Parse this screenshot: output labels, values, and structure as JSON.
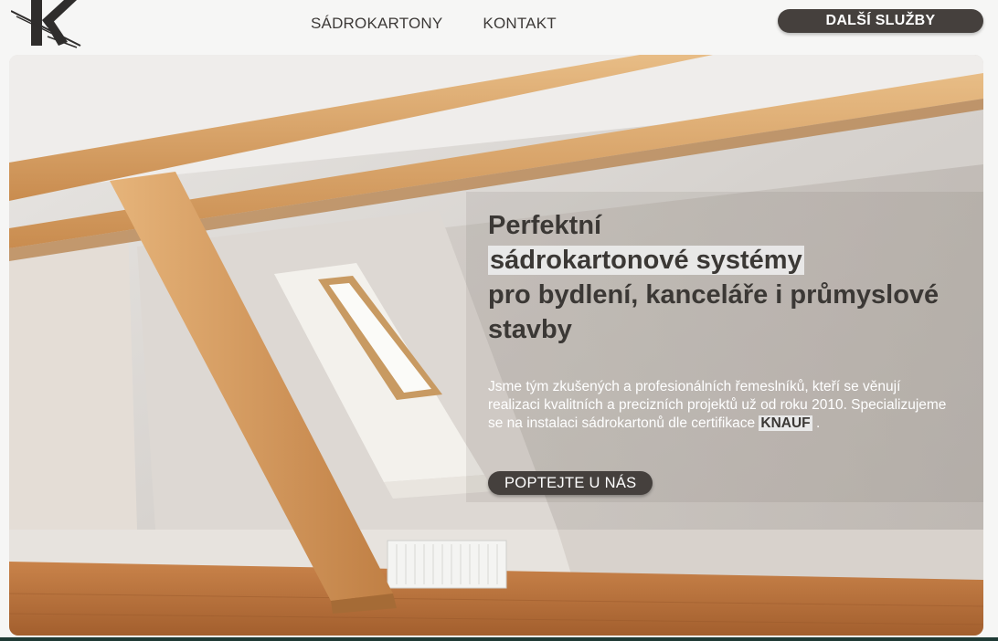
{
  "header": {
    "logo_icon": "k-monogram-logo-icon",
    "nav": [
      {
        "label": "SÁDROKARTONY"
      },
      {
        "label": "KONTAKT"
      }
    ],
    "more_button": "DALŠÍ SLUŽBY"
  },
  "hero": {
    "headline_line1": "Perfektní",
    "headline_highlight": "sádrokartonové systémy",
    "headline_line3": "pro bydlení, kanceláře i průmyslové stavby",
    "description_part1": "Jsme tým zkušených a profesionálních řemeslníků, kteří se věnují realizaci kvalitních a precizních projektů už od roku 2010. Specializujeme se na instalaci sádrokartonů dle certifikace",
    "description_brand": "KNAUF",
    "description_end": ".",
    "cta_button": "POPTEJTE U NÁS",
    "colors": {
      "dark": "#45403d",
      "headline": "#3b3835",
      "wood": "#d9a36a",
      "floor": "#b9713b"
    }
  }
}
